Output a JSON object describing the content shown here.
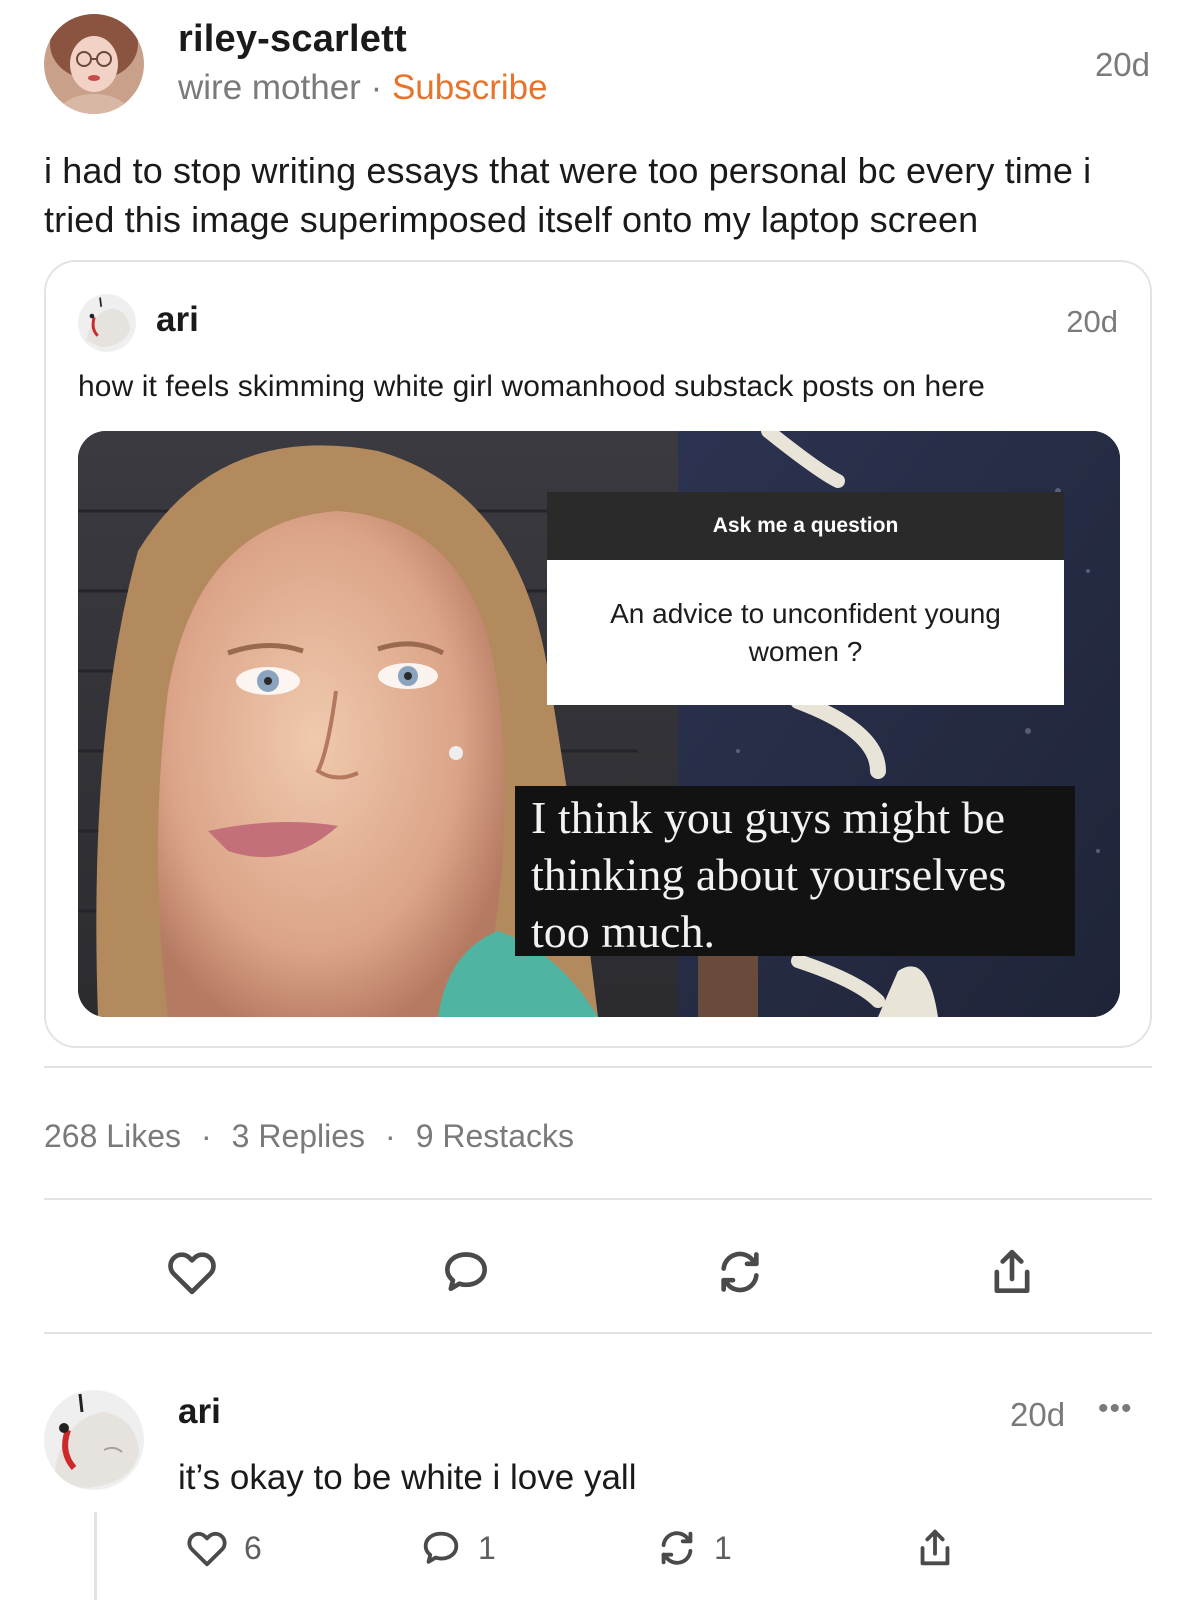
{
  "post": {
    "username": "riley-scarlett",
    "tagline": "wire mother",
    "separator": "·",
    "subscribe_label": "Subscribe",
    "timestamp": "20d",
    "text": "i had to stop writing essays that were too personal bc every time i tried this image superimposed itself onto my laptop screen"
  },
  "quote": {
    "username": "ari",
    "timestamp": "20d",
    "text": "how it feels skimming white girl womanhood substack posts on here",
    "image": {
      "ask_header": "Ask me a question",
      "ask_body": "An advice to unconfident young women ?",
      "caption": "I think you guys might be thinking about yourselves too much."
    }
  },
  "stats": {
    "likes": "268 Likes",
    "replies": "3 Replies",
    "restacks": "9 Restacks",
    "separator": "·"
  },
  "actions": {
    "like_icon": "heart-icon",
    "comment_icon": "comment-icon",
    "restack_icon": "restack-icon",
    "share_icon": "share-icon"
  },
  "reply": {
    "username": "ari",
    "timestamp": "20d",
    "more": "•••",
    "text": "it’s okay to be white i love yall",
    "likes": "6",
    "comments": "1",
    "restacks": "1"
  },
  "colors": {
    "accent": "#e8742c",
    "muted": "#7a7a7a",
    "border": "#e3e3e3"
  }
}
